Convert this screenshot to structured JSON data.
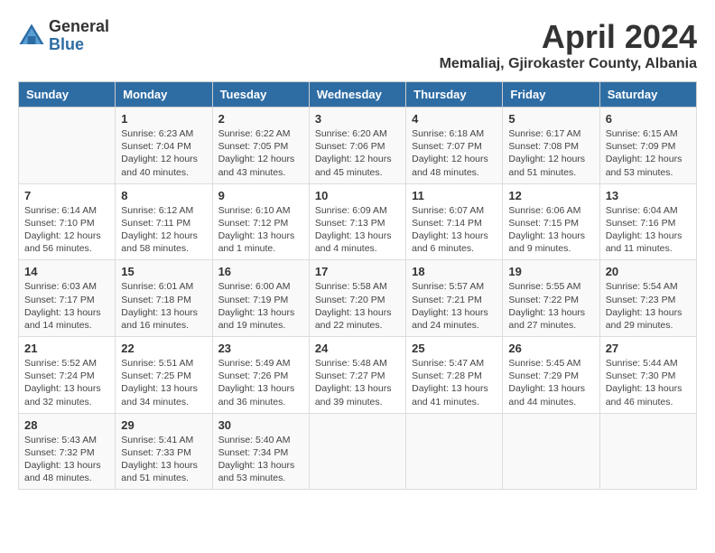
{
  "header": {
    "logo_general": "General",
    "logo_blue": "Blue",
    "month_title": "April 2024",
    "location": "Memaliaj, Gjirokaster County, Albania"
  },
  "days_of_week": [
    "Sunday",
    "Monday",
    "Tuesday",
    "Wednesday",
    "Thursday",
    "Friday",
    "Saturday"
  ],
  "weeks": [
    [
      {
        "day": "",
        "info": ""
      },
      {
        "day": "1",
        "info": "Sunrise: 6:23 AM\nSunset: 7:04 PM\nDaylight: 12 hours\nand 40 minutes."
      },
      {
        "day": "2",
        "info": "Sunrise: 6:22 AM\nSunset: 7:05 PM\nDaylight: 12 hours\nand 43 minutes."
      },
      {
        "day": "3",
        "info": "Sunrise: 6:20 AM\nSunset: 7:06 PM\nDaylight: 12 hours\nand 45 minutes."
      },
      {
        "day": "4",
        "info": "Sunrise: 6:18 AM\nSunset: 7:07 PM\nDaylight: 12 hours\nand 48 minutes."
      },
      {
        "day": "5",
        "info": "Sunrise: 6:17 AM\nSunset: 7:08 PM\nDaylight: 12 hours\nand 51 minutes."
      },
      {
        "day": "6",
        "info": "Sunrise: 6:15 AM\nSunset: 7:09 PM\nDaylight: 12 hours\nand 53 minutes."
      }
    ],
    [
      {
        "day": "7",
        "info": "Sunrise: 6:14 AM\nSunset: 7:10 PM\nDaylight: 12 hours\nand 56 minutes."
      },
      {
        "day": "8",
        "info": "Sunrise: 6:12 AM\nSunset: 7:11 PM\nDaylight: 12 hours\nand 58 minutes."
      },
      {
        "day": "9",
        "info": "Sunrise: 6:10 AM\nSunset: 7:12 PM\nDaylight: 13 hours\nand 1 minute."
      },
      {
        "day": "10",
        "info": "Sunrise: 6:09 AM\nSunset: 7:13 PM\nDaylight: 13 hours\nand 4 minutes."
      },
      {
        "day": "11",
        "info": "Sunrise: 6:07 AM\nSunset: 7:14 PM\nDaylight: 13 hours\nand 6 minutes."
      },
      {
        "day": "12",
        "info": "Sunrise: 6:06 AM\nSunset: 7:15 PM\nDaylight: 13 hours\nand 9 minutes."
      },
      {
        "day": "13",
        "info": "Sunrise: 6:04 AM\nSunset: 7:16 PM\nDaylight: 13 hours\nand 11 minutes."
      }
    ],
    [
      {
        "day": "14",
        "info": "Sunrise: 6:03 AM\nSunset: 7:17 PM\nDaylight: 13 hours\nand 14 minutes."
      },
      {
        "day": "15",
        "info": "Sunrise: 6:01 AM\nSunset: 7:18 PM\nDaylight: 13 hours\nand 16 minutes."
      },
      {
        "day": "16",
        "info": "Sunrise: 6:00 AM\nSunset: 7:19 PM\nDaylight: 13 hours\nand 19 minutes."
      },
      {
        "day": "17",
        "info": "Sunrise: 5:58 AM\nSunset: 7:20 PM\nDaylight: 13 hours\nand 22 minutes."
      },
      {
        "day": "18",
        "info": "Sunrise: 5:57 AM\nSunset: 7:21 PM\nDaylight: 13 hours\nand 24 minutes."
      },
      {
        "day": "19",
        "info": "Sunrise: 5:55 AM\nSunset: 7:22 PM\nDaylight: 13 hours\nand 27 minutes."
      },
      {
        "day": "20",
        "info": "Sunrise: 5:54 AM\nSunset: 7:23 PM\nDaylight: 13 hours\nand 29 minutes."
      }
    ],
    [
      {
        "day": "21",
        "info": "Sunrise: 5:52 AM\nSunset: 7:24 PM\nDaylight: 13 hours\nand 32 minutes."
      },
      {
        "day": "22",
        "info": "Sunrise: 5:51 AM\nSunset: 7:25 PM\nDaylight: 13 hours\nand 34 minutes."
      },
      {
        "day": "23",
        "info": "Sunrise: 5:49 AM\nSunset: 7:26 PM\nDaylight: 13 hours\nand 36 minutes."
      },
      {
        "day": "24",
        "info": "Sunrise: 5:48 AM\nSunset: 7:27 PM\nDaylight: 13 hours\nand 39 minutes."
      },
      {
        "day": "25",
        "info": "Sunrise: 5:47 AM\nSunset: 7:28 PM\nDaylight: 13 hours\nand 41 minutes."
      },
      {
        "day": "26",
        "info": "Sunrise: 5:45 AM\nSunset: 7:29 PM\nDaylight: 13 hours\nand 44 minutes."
      },
      {
        "day": "27",
        "info": "Sunrise: 5:44 AM\nSunset: 7:30 PM\nDaylight: 13 hours\nand 46 minutes."
      }
    ],
    [
      {
        "day": "28",
        "info": "Sunrise: 5:43 AM\nSunset: 7:32 PM\nDaylight: 13 hours\nand 48 minutes."
      },
      {
        "day": "29",
        "info": "Sunrise: 5:41 AM\nSunset: 7:33 PM\nDaylight: 13 hours\nand 51 minutes."
      },
      {
        "day": "30",
        "info": "Sunrise: 5:40 AM\nSunset: 7:34 PM\nDaylight: 13 hours\nand 53 minutes."
      },
      {
        "day": "",
        "info": ""
      },
      {
        "day": "",
        "info": ""
      },
      {
        "day": "",
        "info": ""
      },
      {
        "day": "",
        "info": ""
      }
    ]
  ]
}
